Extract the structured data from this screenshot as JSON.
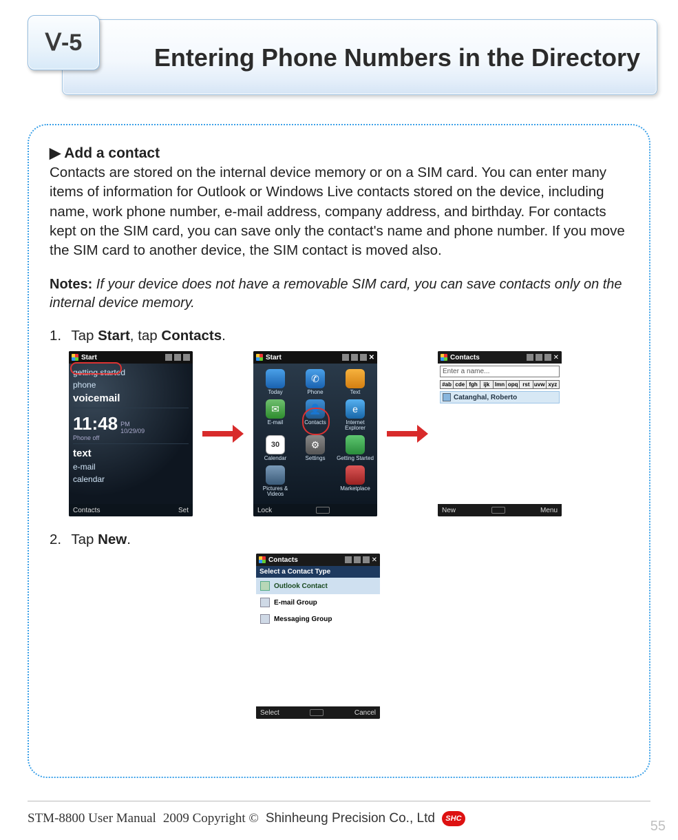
{
  "chapter_badge": "Ⅴ-5",
  "page_title": "Entering Phone Numbers in the Directory",
  "section_heading_prefix": "▶",
  "section_heading": "Add a contact",
  "body_paragraph": "Contacts are stored on the internal device memory or on a SIM card. You can enter many items of information for Outlook or Windows Live contacts stored on the device, including name, work phone number, e-mail address, company address, and birthday. For contacts kept on the SIM card, you can save only the contact's name and phone number. If you move the SIM card to another device, the SIM contact is moved also.",
  "notes_label": "Notes:",
  "notes_text": "If your device does not have a removable SIM card, you can save contacts only on the internal device memory.",
  "steps": [
    {
      "num": "1.",
      "pre": "Tap ",
      "b1": "Start",
      "mid": ", tap ",
      "b2": "Contacts",
      "post": "."
    },
    {
      "num": "2.",
      "pre": "Tap ",
      "b1": "New",
      "mid": "",
      "b2": "",
      "post": "."
    }
  ],
  "screens": {
    "s1": {
      "status_title": "Start",
      "items": [
        "getting started",
        "phone",
        "voicemail"
      ],
      "clock": "11:48",
      "ampm": "PM",
      "date": "10/29/09",
      "phone_off": "Phone off",
      "items2": [
        "text",
        "e-mail",
        "calendar"
      ],
      "soft_left": "Contacts",
      "soft_right": "Set"
    },
    "s2": {
      "status_title": "Start",
      "apps": [
        "Today",
        "Phone",
        "Text",
        "E-mail",
        "Contacts",
        "Internet Explorer",
        "Calendar",
        "Settings",
        "Getting Started",
        "Pictures & Videos",
        "",
        "Marketplace"
      ],
      "cal_num": "30",
      "soft_left": "Lock",
      "soft_right": ""
    },
    "s3": {
      "status_title": "Contacts",
      "search_placeholder": "Enter a name...",
      "alpha": [
        "#ab",
        "cde",
        "fgh",
        "ijk",
        "lmn",
        "opq",
        "rst",
        "uvw",
        "xyz"
      ],
      "contact": "Catanghal, Roberto",
      "soft_left": "New",
      "soft_right": "Menu"
    },
    "s4": {
      "status_title": "Contacts",
      "header": "Select a Contact Type",
      "types": [
        "Outlook Contact",
        "E-mail Group",
        "Messaging Group"
      ],
      "soft_left": "Select",
      "soft_right": "Cancel"
    }
  },
  "footer": {
    "manual": "STM-8800 User Manual",
    "copyright": "2009 Copyright © ",
    "company": "Shinheung Precision Co., Ltd",
    "badge": "SHC"
  },
  "page_number": "55"
}
